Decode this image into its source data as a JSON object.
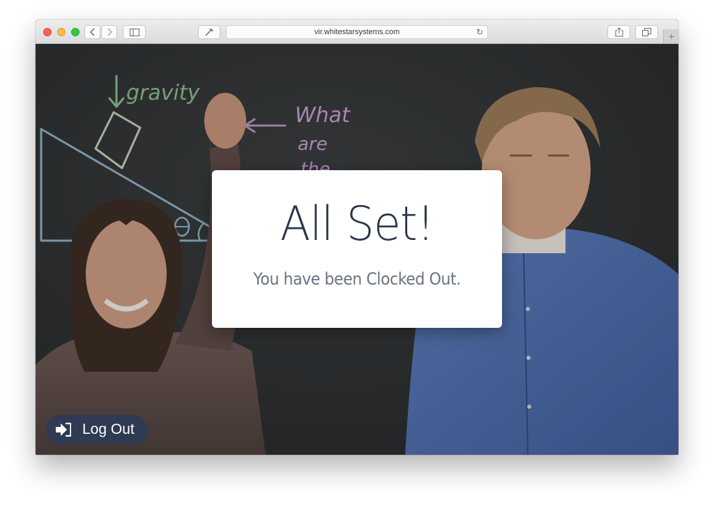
{
  "browser": {
    "url": "vir.whitestarsystems.com"
  },
  "modal": {
    "title": "All Set!",
    "message": "You have been Clocked Out."
  },
  "logout_button": {
    "label": "Log Out",
    "icon": "sign-out-icon"
  },
  "background": {
    "chalkboard_words": [
      "gravity",
      "What",
      "are",
      "the"
    ]
  }
}
